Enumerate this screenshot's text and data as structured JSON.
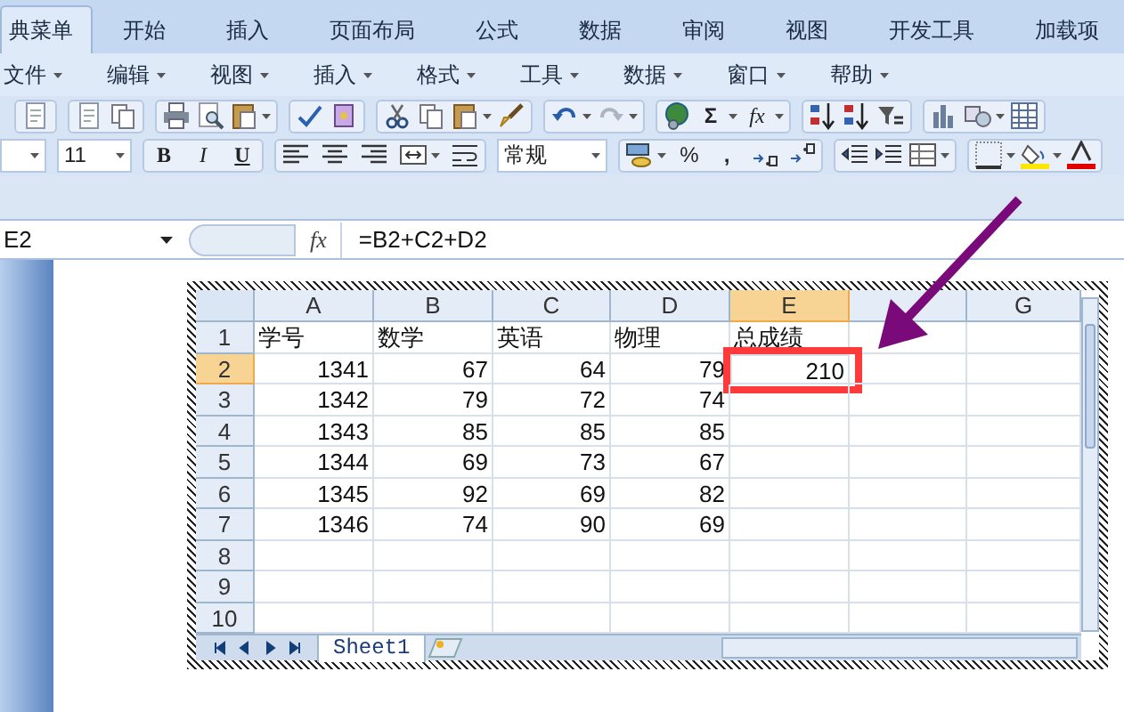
{
  "ribbon_tabs": [
    {
      "label": "典菜单",
      "selected": true
    },
    {
      "label": "开始",
      "selected": false
    },
    {
      "label": "插入",
      "selected": false
    },
    {
      "label": "页面布局",
      "selected": false
    },
    {
      "label": "公式",
      "selected": false
    },
    {
      "label": "数据",
      "selected": false
    },
    {
      "label": "审阅",
      "selected": false
    },
    {
      "label": "视图",
      "selected": false
    },
    {
      "label": "开发工具",
      "selected": false
    },
    {
      "label": "加载项",
      "selected": false
    }
  ],
  "menu": [
    "文件",
    "编辑",
    "视图",
    "插入",
    "格式",
    "工具",
    "数据",
    "窗口",
    "帮助"
  ],
  "toolbar_1": {
    "sum_button": "Σ",
    "function_button": "fx"
  },
  "toolbar_2": {
    "font_size": "11",
    "bold_button": "B",
    "italic_button": "I",
    "underline_button": "U",
    "number_format": "常规",
    "percent_button": "%",
    "comma_button": ","
  },
  "formula_bar": {
    "name_box": "E2",
    "fx_label": "fx",
    "formula": "=B2+C2+D2"
  },
  "sheet": {
    "columns": [
      {
        "label": "A",
        "selected": false
      },
      {
        "label": "B",
        "selected": false
      },
      {
        "label": "C",
        "selected": false
      },
      {
        "label": "D",
        "selected": false
      },
      {
        "label": "E",
        "selected": true
      },
      {
        "selected": false
      },
      {
        "label": "G",
        "selected": false
      }
    ],
    "rows": [
      {
        "label": "1",
        "selected": false,
        "cells": [
          "学号",
          "数学",
          "英语",
          "物理",
          "总成绩"
        ]
      },
      {
        "label": "2",
        "selected": true,
        "cells": [
          "1341",
          "67",
          "64",
          "79",
          {
            "text": "210",
            "boxed": true
          }
        ]
      },
      {
        "label": "3",
        "selected": false,
        "cells": [
          "1342",
          "79",
          "72",
          "74"
        ]
      },
      {
        "label": "4",
        "selected": false,
        "cells": [
          "1343",
          "85",
          "85",
          "85"
        ]
      },
      {
        "label": "5",
        "selected": false,
        "cells": [
          "1344",
          "69",
          "73",
          "67"
        ]
      },
      {
        "label": "6",
        "selected": false,
        "cells": [
          "1345",
          "92",
          "69",
          "82"
        ]
      },
      {
        "label": "7",
        "selected": false,
        "cells": [
          "1346",
          "74",
          "90",
          "69"
        ]
      },
      {
        "label": "8",
        "selected": false,
        "cells": []
      },
      {
        "label": "9",
        "selected": false,
        "cells": []
      },
      {
        "label": "10",
        "selected": false,
        "cells": []
      }
    ],
    "sheet_tab": "Sheet1"
  }
}
